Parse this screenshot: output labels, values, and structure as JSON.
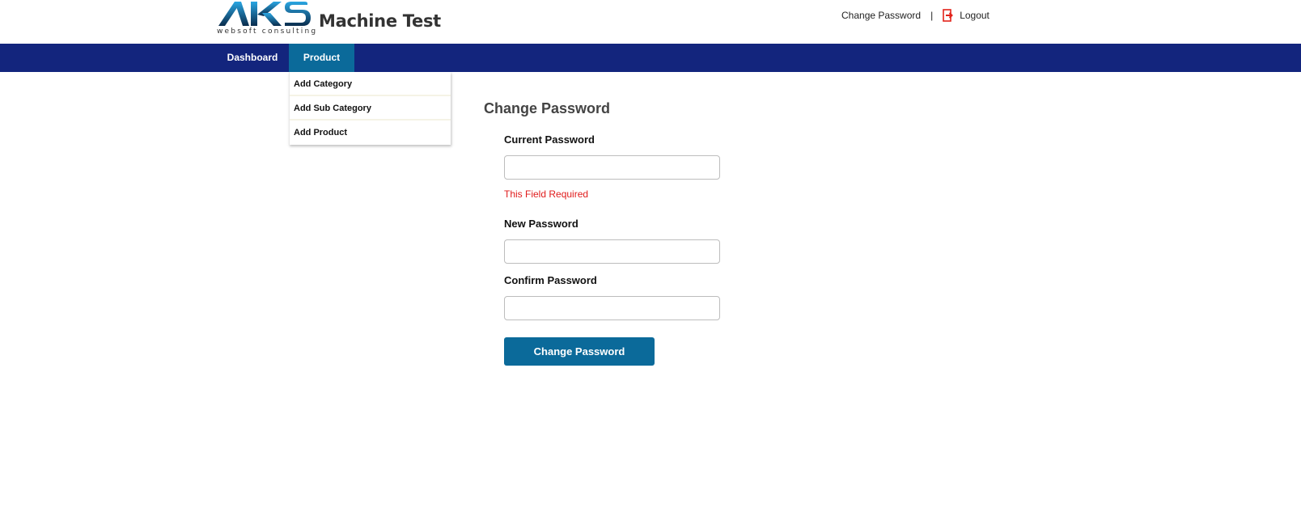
{
  "header": {
    "logo_text": "AKS",
    "logo_subtext": "websoft consulting",
    "app_title": "Machine Test",
    "links": {
      "change_password": "Change Password",
      "separator": "|",
      "logout": "Logout"
    },
    "logout_icon": "logout-icon"
  },
  "nav": {
    "items": [
      {
        "label": "Dashboard",
        "active": false
      },
      {
        "label": "Product",
        "active": true
      }
    ],
    "dropdown": [
      "Add Category",
      "Add Sub Category",
      "Add Product"
    ]
  },
  "form": {
    "title": "Change Password",
    "current_label": "Current Password",
    "current_value": "",
    "current_error": "This Field Required",
    "new_label": "New Password",
    "new_value": "",
    "confirm_label": "Confirm Password",
    "confirm_value": "",
    "submit_label": "Change Password"
  },
  "colors": {
    "navbar": "#13257d",
    "accent": "#0b6a9a",
    "error": "#e01b1b",
    "logout_icon": "#e2231a"
  }
}
